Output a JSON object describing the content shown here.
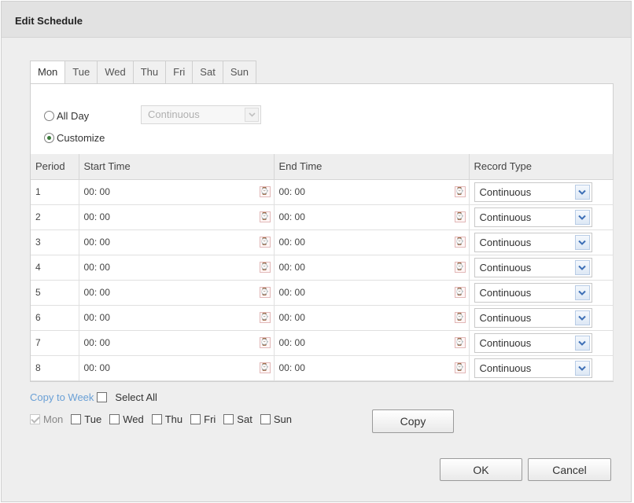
{
  "dialog": {
    "title": "Edit Schedule"
  },
  "tabs": [
    "Mon",
    "Tue",
    "Wed",
    "Thu",
    "Fri",
    "Sat",
    "Sun"
  ],
  "active_tab": "Mon",
  "mode": {
    "all_day_label": "All Day",
    "customize_label": "Customize",
    "selected": "customize",
    "all_day_type": "Continuous"
  },
  "table": {
    "headers": {
      "period": "Period",
      "start": "Start Time",
      "end": "End Time",
      "type": "Record Type"
    },
    "rows": [
      {
        "period": "1",
        "start": "00: 00",
        "end": "00: 00",
        "type": "Continuous"
      },
      {
        "period": "2",
        "start": "00: 00",
        "end": "00: 00",
        "type": "Continuous"
      },
      {
        "period": "3",
        "start": "00: 00",
        "end": "00: 00",
        "type": "Continuous"
      },
      {
        "period": "4",
        "start": "00: 00",
        "end": "00: 00",
        "type": "Continuous"
      },
      {
        "period": "5",
        "start": "00: 00",
        "end": "00: 00",
        "type": "Continuous"
      },
      {
        "period": "6",
        "start": "00: 00",
        "end": "00: 00",
        "type": "Continuous"
      },
      {
        "period": "7",
        "start": "00: 00",
        "end": "00: 00",
        "type": "Continuous"
      },
      {
        "period": "8",
        "start": "00: 00",
        "end": "00: 00",
        "type": "Continuous"
      }
    ]
  },
  "copy": {
    "link_label": "Copy to Week",
    "select_all_label": "Select All",
    "days": [
      {
        "label": "Mon",
        "checked": true,
        "disabled": true
      },
      {
        "label": "Tue",
        "checked": false,
        "disabled": false
      },
      {
        "label": "Wed",
        "checked": false,
        "disabled": false
      },
      {
        "label": "Thu",
        "checked": false,
        "disabled": false
      },
      {
        "label": "Fri",
        "checked": false,
        "disabled": false
      },
      {
        "label": "Sat",
        "checked": false,
        "disabled": false
      },
      {
        "label": "Sun",
        "checked": false,
        "disabled": false
      }
    ],
    "button_label": "Copy"
  },
  "footer": {
    "ok_label": "OK",
    "cancel_label": "Cancel"
  },
  "icons": {
    "time_picker": "clock-icon",
    "dropdown": "chevron-down-icon"
  },
  "colors": {
    "link": "#6aa0d6",
    "dropdown_arrow": "#3d6fb6",
    "radio_selected": "#3a7a3a"
  }
}
